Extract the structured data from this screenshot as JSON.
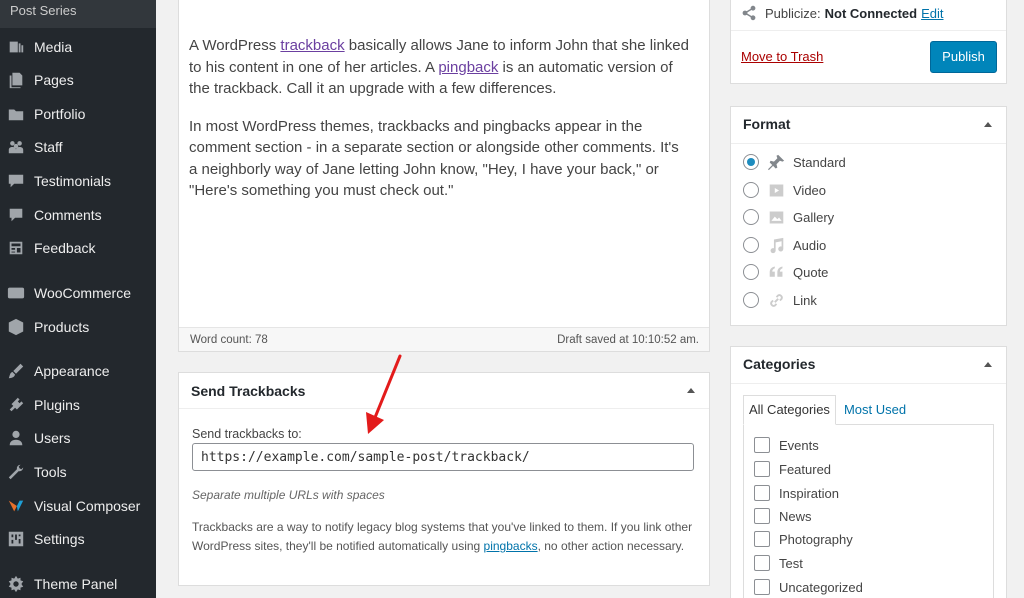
{
  "sidebar": {
    "top_item": "Post Series",
    "items": [
      {
        "label": "Media",
        "icon": "media-icon"
      },
      {
        "label": "Pages",
        "icon": "pages-icon"
      },
      {
        "label": "Portfolio",
        "icon": "portfolio-icon"
      },
      {
        "label": "Staff",
        "icon": "staff-icon"
      },
      {
        "label": "Testimonials",
        "icon": "testimonials-icon"
      },
      {
        "label": "Comments",
        "icon": "comments-icon"
      },
      {
        "label": "Feedback",
        "icon": "feedback-icon"
      },
      {
        "label": "WooCommerce",
        "icon": "woocommerce-icon"
      },
      {
        "label": "Products",
        "icon": "products-icon"
      },
      {
        "label": "Appearance",
        "icon": "appearance-icon"
      },
      {
        "label": "Plugins",
        "icon": "plugins-icon"
      },
      {
        "label": "Users",
        "icon": "users-icon"
      },
      {
        "label": "Tools",
        "icon": "tools-icon"
      },
      {
        "label": "Visual Composer",
        "icon": "visual-composer-icon"
      },
      {
        "label": "Settings",
        "icon": "settings-icon"
      },
      {
        "label": "Theme Panel",
        "icon": "theme-panel-icon"
      }
    ]
  },
  "editor": {
    "p1_before": "A WordPress ",
    "p1_link1": "trackback",
    "p1_mid": " basically allows Jane to inform John that she linked to his content in one of her articles. A ",
    "p1_link2": "pingback",
    "p1_after": " is an automatic version of the trackback. Call it an upgrade with a few differences.",
    "p2": "In most WordPress themes, trackbacks and pingbacks appear in the comment section - in a separate section or alongside other comments. It's a neighborly way of Jane letting John know, \"Hey, I have your back,\" or \"Here's something you must check out.\"",
    "word_count": "Word count: 78",
    "draft_saved": "Draft saved at 10:10:52 am."
  },
  "trackbacks": {
    "title": "Send Trackbacks",
    "label": "Send trackbacks to:",
    "value": "https://example.com/sample-post/trackback/",
    "hint": "Separate multiple URLs with spaces",
    "desc_before": "Trackbacks are a way to notify legacy blog systems that you've linked to them. If you link other WordPress sites, they'll be notified automatically using ",
    "desc_link": "pingbacks",
    "desc_after": ", no other action necessary."
  },
  "publish": {
    "publicize_label": "Publicize:",
    "publicize_status": "Not Connected",
    "edit_link": "Edit",
    "trash": "Move to Trash",
    "publish_button": "Publish"
  },
  "format": {
    "title": "Format",
    "options": [
      {
        "label": "Standard",
        "icon": "pin-icon",
        "selected": true
      },
      {
        "label": "Video",
        "icon": "video-icon",
        "selected": false
      },
      {
        "label": "Gallery",
        "icon": "gallery-icon",
        "selected": false
      },
      {
        "label": "Audio",
        "icon": "audio-icon",
        "selected": false
      },
      {
        "label": "Quote",
        "icon": "quote-icon",
        "selected": false
      },
      {
        "label": "Link",
        "icon": "link-icon",
        "selected": false
      }
    ]
  },
  "categories": {
    "title": "Categories",
    "tab_all": "All Categories",
    "tab_used": "Most Used",
    "items": [
      "Events",
      "Featured",
      "Inspiration",
      "News",
      "Photography",
      "Test",
      "Uncategorized"
    ]
  },
  "colors": {
    "sidebar_bg": "#23282d",
    "accent": "#0085ba",
    "link": "#0073aa",
    "trash": "#a00",
    "arrow": "#e31b1b"
  }
}
